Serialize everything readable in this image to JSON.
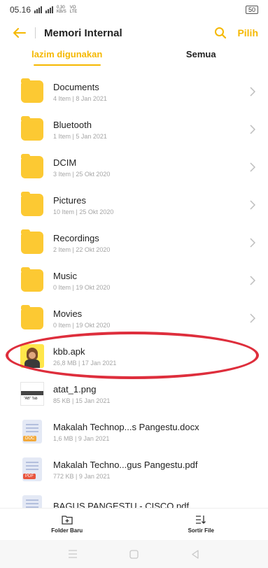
{
  "status_bar": {
    "time": "05.16",
    "net_top": "0,30",
    "net_bottom": "KB/S",
    "net_type_top": "VO",
    "net_type_bottom": "LTE",
    "battery": "50"
  },
  "header": {
    "title": "Memori Internal",
    "select_label": "Pilih"
  },
  "tabs": [
    {
      "label": "lazim digunakan",
      "active": true
    },
    {
      "label": "Semua",
      "active": false
    }
  ],
  "files": [
    {
      "name": "Documents",
      "meta": "4 Item | 8 Jan 2021",
      "type": "folder"
    },
    {
      "name": "Bluetooth",
      "meta": "1 Item | 5 Jan 2021",
      "type": "folder"
    },
    {
      "name": "DCIM",
      "meta": "3 Item | 25 Okt 2020",
      "type": "folder"
    },
    {
      "name": "Pictures",
      "meta": "10 Item | 25 Okt 2020",
      "type": "folder"
    },
    {
      "name": "Recordings",
      "meta": "2 Item | 22 Okt 2020",
      "type": "folder"
    },
    {
      "name": "Music",
      "meta": "0 Item | 19 Okt 2020",
      "type": "folder"
    },
    {
      "name": "Movies",
      "meta": "0 Item | 19 Okt 2020",
      "type": "folder"
    },
    {
      "name": "kbb.apk",
      "meta": "26,8 MB | 17 Jan 2021",
      "type": "apk"
    },
    {
      "name": "atat_1.png",
      "meta": "85 KB | 15 Jan 2021",
      "type": "image"
    },
    {
      "name": "Makalah Technop...s Pangestu.docx",
      "meta": "1,6 MB | 9 Jan 2021",
      "type": "doc",
      "badge": "DOC"
    },
    {
      "name": "Makalah Techno...gus Pangestu.pdf",
      "meta": "772 KB | 9 Jan 2021",
      "type": "pdf",
      "badge": "PDF"
    },
    {
      "name": "BAGUS PANGESTU - CISCO.pdf",
      "meta": "",
      "type": "pdf"
    }
  ],
  "bottom_actions": {
    "new_folder": "Folder Baru",
    "sort": "Sortir File"
  },
  "colors": {
    "accent": "#f5b800",
    "folder": "#fcc933",
    "highlight": "#de2e3c",
    "doc_badge": "#f2a93b",
    "pdf_badge": "#e8553e"
  }
}
